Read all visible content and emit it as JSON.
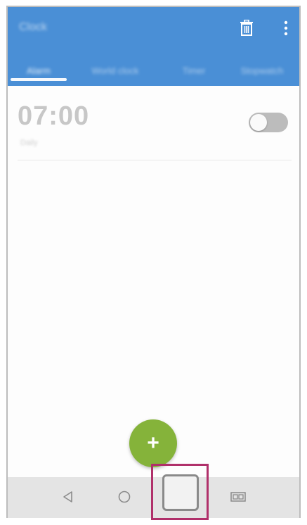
{
  "app_bar": {
    "title": "Clock",
    "actions": [
      {
        "name": "delete",
        "icon": "trash-icon"
      },
      {
        "name": "more-options",
        "icon": "more-vert-icon"
      }
    ]
  },
  "tabs": [
    {
      "label": "Alarm",
      "active": true
    },
    {
      "label": "World clock",
      "active": false
    },
    {
      "label": "Timer",
      "active": false
    },
    {
      "label": "Stopwatch",
      "active": false
    }
  ],
  "alarm": {
    "time": "07:00",
    "subtitle": "Daily",
    "enabled": false
  },
  "fab": {
    "label": "+",
    "icon": "add-icon"
  },
  "nav_bar": {
    "buttons": [
      {
        "name": "back",
        "icon": "back-triangle-icon"
      },
      {
        "name": "home",
        "icon": "home-circle-icon"
      },
      {
        "name": "overview",
        "icon": "square-icon"
      },
      {
        "name": "dual-window",
        "icon": "dual-window-icon"
      }
    ]
  },
  "highlight": {
    "target": "overview-button",
    "color": "#b0306a"
  },
  "colors": {
    "app_bar": "#4a8fd6",
    "fab": "#85b33a",
    "toggle_off": "#bcbcbc",
    "nav_bar": "#e4e4e4"
  }
}
